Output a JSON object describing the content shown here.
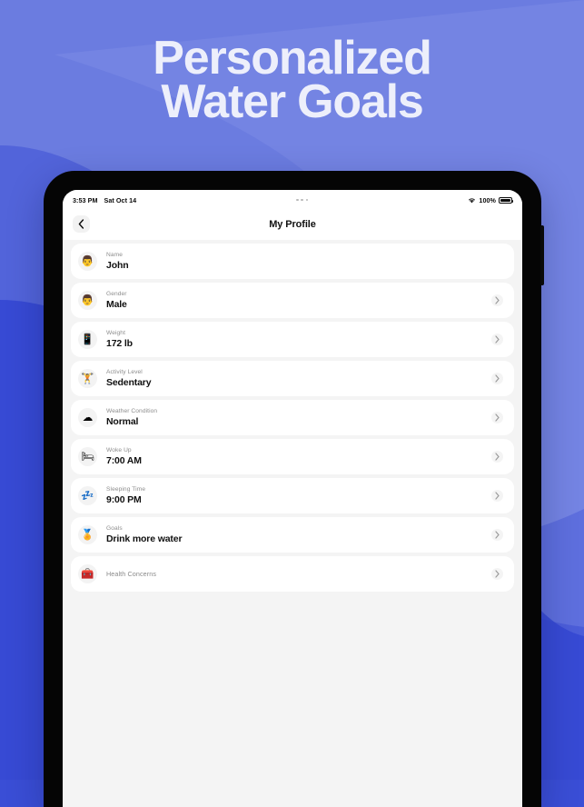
{
  "headline": {
    "line1": "Personalized",
    "line2": "Water Goals",
    "color": "#edeffb"
  },
  "background": {
    "base_color": "#3a4ed6",
    "light_color": "#6b7ce0",
    "mid_color": "#5667dc"
  },
  "status_bar": {
    "time": "3:53 PM",
    "date": "Sat Oct 14",
    "multitask_indicator": "multitask-dots-icon",
    "wifi_icon": "wifi-icon",
    "battery_percent": "100%",
    "battery_icon": "battery-full-icon"
  },
  "nav": {
    "back_icon": "chevron-left-icon",
    "title": "My Profile"
  },
  "profile_rows": [
    {
      "emoji": "👨",
      "icon_name": "person-emoji",
      "label": "Name",
      "value": "John",
      "has_chevron": false
    },
    {
      "emoji": "👨",
      "icon_name": "man-emoji",
      "label": "Gender",
      "value": "Male",
      "has_chevron": true
    },
    {
      "emoji": "📱",
      "icon_name": "scale-emoji",
      "label": "Weight",
      "value": "172 lb",
      "has_chevron": true
    },
    {
      "emoji": "🏋",
      "icon_name": "weightlifter-emoji",
      "label": "Activity Level",
      "value": "Sedentary",
      "has_chevron": true
    },
    {
      "emoji": "☁",
      "icon_name": "cloud-emoji",
      "label": "Weather Condition",
      "value": "Normal",
      "has_chevron": true
    },
    {
      "emoji": "🛏",
      "icon_name": "bed-emoji",
      "label": "Woke Up",
      "value": "7:00 AM",
      "has_chevron": true
    },
    {
      "emoji": "💤",
      "icon_name": "zzz-emoji",
      "label": "Sleeping Time",
      "value": "9:00 PM",
      "has_chevron": true
    },
    {
      "emoji": "🏅",
      "icon_name": "medal-emoji",
      "label": "Goals",
      "value": "Drink more water",
      "has_chevron": true
    },
    {
      "emoji": "🧰",
      "icon_name": "first-aid-kit-emoji",
      "label": "Health Concerns",
      "value": "",
      "has_chevron": true
    }
  ]
}
